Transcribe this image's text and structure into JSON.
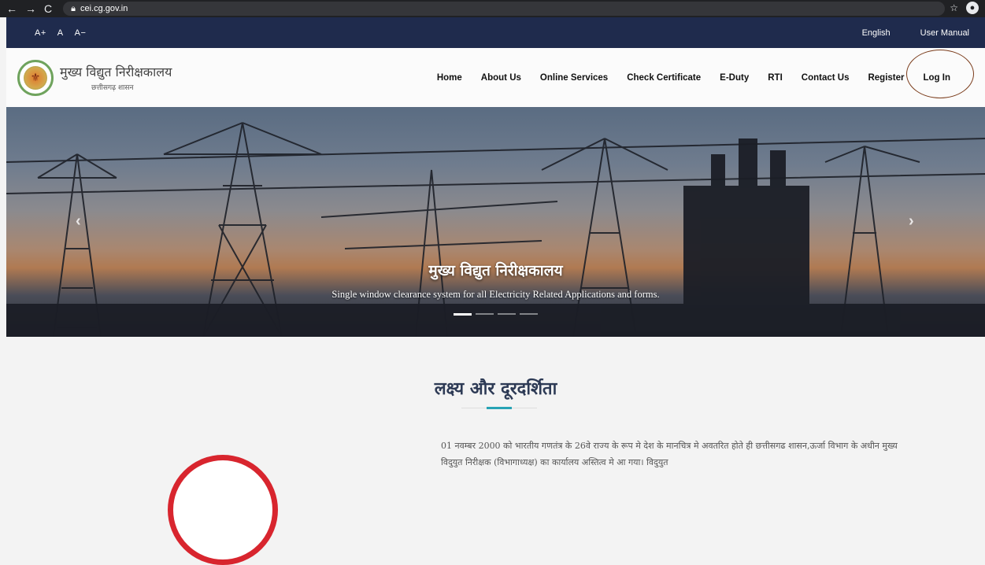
{
  "browser": {
    "url": "cei.cg.gov.in",
    "back_icon": "←",
    "forward_icon": "→",
    "reload_icon": "C",
    "star_icon": "☆"
  },
  "utility": {
    "font_increase": "A+",
    "font_normal": "A",
    "font_decrease": "A−",
    "language": "English",
    "user_manual": "User Manual"
  },
  "header": {
    "title": "मुख्य विद्युत निरीक्षकालय",
    "subtitle": "छत्तीसगढ़ शासन",
    "menu": [
      {
        "label": "Home"
      },
      {
        "label": "About Us"
      },
      {
        "label": "Online Services"
      },
      {
        "label": "Check Certificate"
      },
      {
        "label": "E-Duty"
      },
      {
        "label": "RTI"
      },
      {
        "label": "Contact Us"
      },
      {
        "label": "Register"
      },
      {
        "label": "Log In"
      }
    ]
  },
  "hero": {
    "title": "मुख्य विद्युत निरीक्षकालय",
    "subtitle": "Single window clearance system for all Electricity Related Applications and forms.",
    "prev_icon": "‹",
    "next_icon": "›"
  },
  "mission": {
    "heading": "लक्ष्य और दूरदर्शिता",
    "text": "01 नवम्बर 2000 को भारतीय गणतंत्र के 26वे राज्य के रूप मे देश के मानचित्र मे अवतरित होते ही छत्तीसगढ शासन,ऊर्जा विभाग के अधीन मुख्य विदुयुत निरीक्षक (विभागाध्यक्ष) का कार्यालय अस्तित्व मे आ गया। विदुयुत"
  }
}
